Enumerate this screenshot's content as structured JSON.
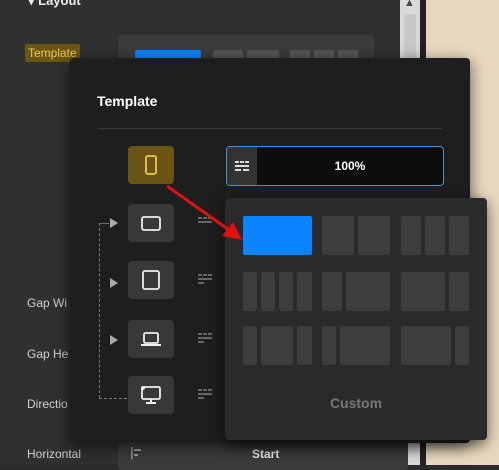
{
  "background": {
    "section_title": "Layout",
    "template_label": "Template",
    "labels": {
      "gap_width": "Gap Wi",
      "gap_height": "Gap He",
      "direction": "Directio",
      "horizontal": "Horizontal"
    },
    "horizontal_value": "Start"
  },
  "popup": {
    "title": "Template",
    "zoom_value": "100%",
    "devices": [
      {
        "name": "mobile-icon",
        "active": true
      },
      {
        "name": "tablet-landscape-icon",
        "active": false
      },
      {
        "name": "tablet-icon",
        "active": false
      },
      {
        "name": "laptop-icon",
        "active": false
      },
      {
        "name": "desktop-icon",
        "active": false
      }
    ]
  },
  "picker": {
    "custom_label": "Custom",
    "selected_layout": "1 column",
    "layouts": [
      "1 column",
      "2 columns",
      "3 columns",
      "4 columns",
      "2+2+1",
      "1+2",
      "2+1",
      "3 split",
      "2 split",
      "1+1+1",
      "1+2 wide"
    ]
  },
  "colors": {
    "accent_blue": "#0a84ff",
    "active_gold": "#6b5515",
    "highlight_text": "#f0c850",
    "arrow_red": "#e01010"
  }
}
